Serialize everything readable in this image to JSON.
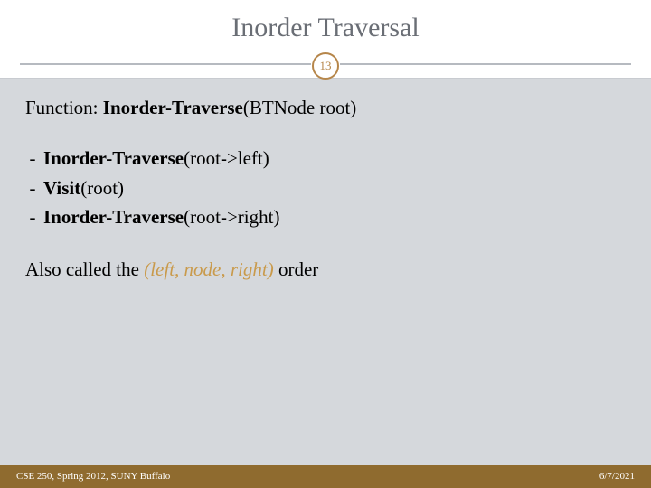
{
  "title": "Inorder Traversal",
  "pageNumber": "13",
  "func": {
    "label": "Function: ",
    "name": "Inorder-Traverse",
    "args": "(BTNode root)"
  },
  "steps": [
    {
      "bold": "Inorder-Traverse",
      "rest": "(root->left)"
    },
    {
      "bold": "Visit",
      "rest": "(root)"
    },
    {
      "bold": "Inorder-Traverse",
      "rest": "(root->right)"
    }
  ],
  "also": {
    "pre": "Also called the ",
    "emph": "(left, node, right)",
    "post": " order"
  },
  "footer": {
    "left": "CSE 250, Spring 2012, SUNY Buffalo",
    "right": "6/7/2021"
  }
}
